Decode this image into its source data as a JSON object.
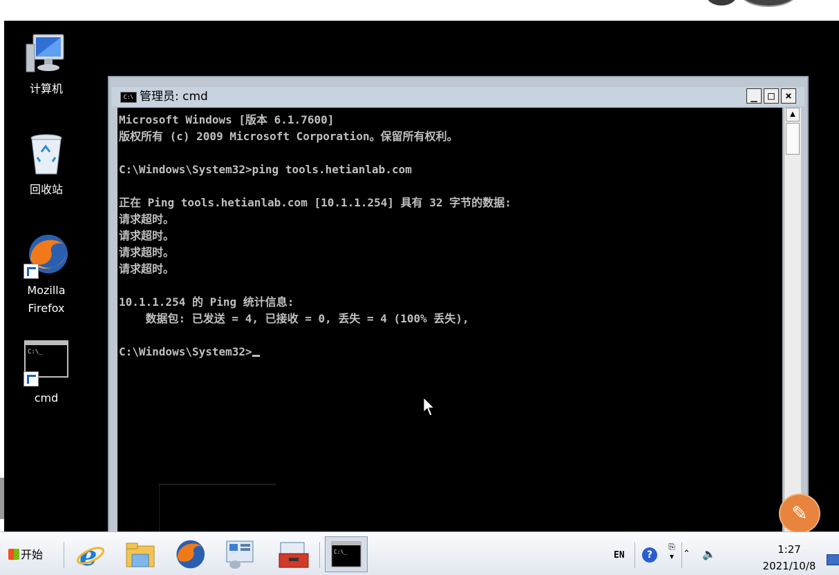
{
  "desktop": {
    "icons": [
      {
        "label": "计算机",
        "icon": "computer-icon"
      },
      {
        "label": "回收站",
        "icon": "recycle-bin-icon"
      },
      {
        "label": "Mozilla\nFirefox",
        "icon": "firefox-icon"
      },
      {
        "label": "cmd",
        "icon": "cmd-shortcut-icon"
      }
    ]
  },
  "cmd_window": {
    "title": "管理员: cmd",
    "icon_text": "C:\\",
    "buttons": {
      "minimize": "_",
      "maximize": "□",
      "close": "×"
    },
    "lines": [
      "Microsoft Windows [版本 6.1.7600]",
      "版权所有 (c) 2009 Microsoft Corporation。保留所有权利。",
      "",
      "C:\\Windows\\System32>ping tools.hetianlab.com",
      "",
      "正在 Ping tools.hetianlab.com [10.1.1.254] 具有 32 字节的数据:",
      "请求超时。",
      "请求超时。",
      "请求超时。",
      "请求超时。",
      "",
      "10.1.1.254 的 Ping 统计信息:",
      "    数据包: 已发送 = 4, 已接收 = 0, 丢失 = 4 (100% 丢失),",
      ""
    ],
    "prompt": "C:\\Windows\\System32>"
  },
  "taskbar": {
    "start_label": "开始",
    "pinned": [
      {
        "name": "internet-explorer-icon"
      },
      {
        "name": "file-explorer-icon"
      },
      {
        "name": "firefox-icon"
      },
      {
        "name": "server-manager-icon"
      },
      {
        "name": "toolbox-icon"
      },
      {
        "name": "cmd-icon",
        "active": true
      }
    ],
    "tray": {
      "language": "EN",
      "help": "?",
      "time": "1:27",
      "date": "2021/10/8"
    }
  },
  "colors": {
    "desktop_bg": "#000000",
    "console_text": "#c0c0c0",
    "titlebar": "#c8d3e0",
    "badge": "#e8843d"
  }
}
